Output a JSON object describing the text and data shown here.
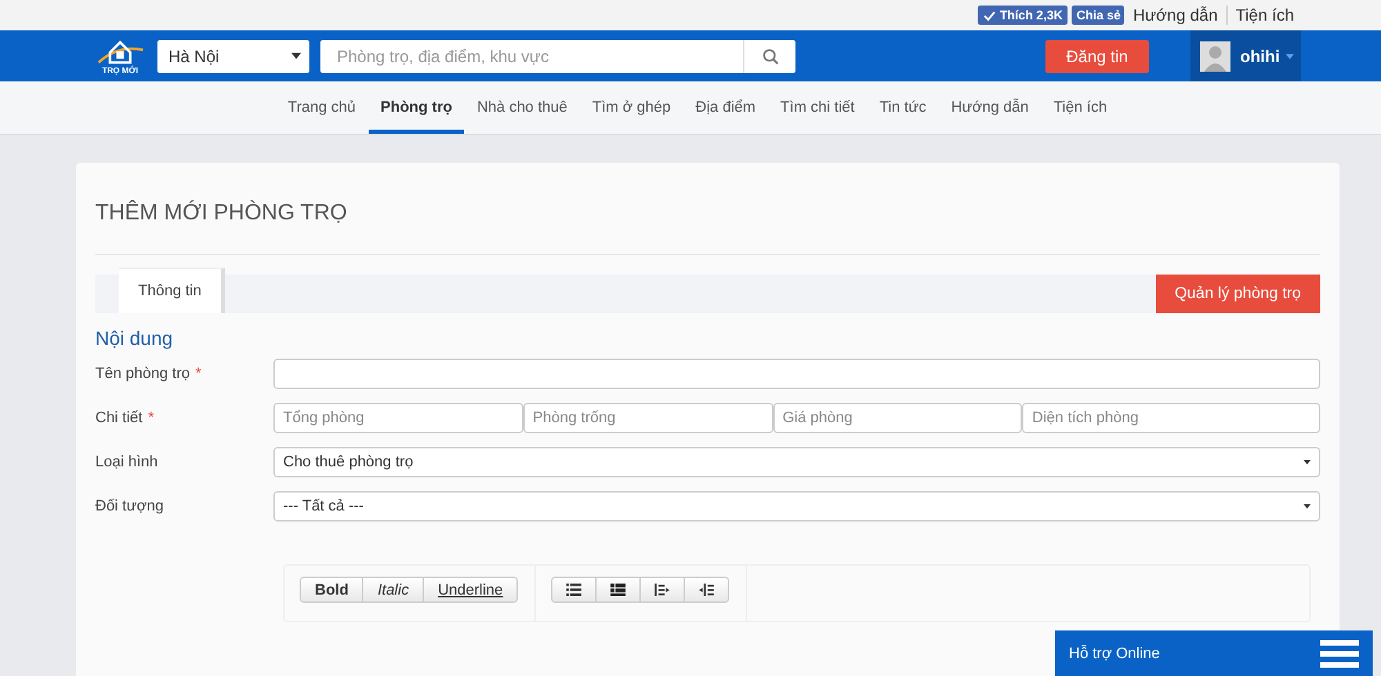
{
  "top_bar": {
    "like": "Thích 2,3K",
    "share": "Chia sẻ",
    "links": [
      "Hướng dẫn",
      "Tiện ích"
    ]
  },
  "header": {
    "logo_text": "TRỌ MỚI",
    "city": "Hà Nội",
    "search_placeholder": "Phòng trọ, địa điểm, khu vực",
    "post_button": "Đăng tin",
    "user": "ohihi"
  },
  "nav": [
    {
      "label": "Trang chủ",
      "selected": false
    },
    {
      "label": "Phòng trọ",
      "selected": true
    },
    {
      "label": "Nhà cho thuê",
      "selected": false
    },
    {
      "label": "Tìm ở ghép",
      "selected": false
    },
    {
      "label": "Địa điểm",
      "selected": false
    },
    {
      "label": "Tìm chi tiết",
      "selected": false
    },
    {
      "label": "Tin tức",
      "selected": false
    },
    {
      "label": "Hướng dẫn",
      "selected": false
    },
    {
      "label": "Tiện ích",
      "selected": false
    }
  ],
  "page_title": "THÊM MỚI PHÒNG TRỌ",
  "tabs": [
    {
      "label": "Thông tin",
      "selected": true
    }
  ],
  "manage_button": "Quản lý phòng trọ",
  "section_title": "Nội dung",
  "fields": [
    {
      "kind": "text",
      "label": "Tên phòng trọ",
      "required_mark": "*"
    },
    {
      "kind": "multi",
      "label": "Chi tiết",
      "required_mark": "*",
      "placeholders": [
        "Tổng phòng",
        "Phòng trống",
        "Giá phòng",
        "Diện tích phòng"
      ]
    },
    {
      "kind": "select",
      "label": "Loại hình",
      "value": "Cho thuê phòng trọ"
    },
    {
      "kind": "select",
      "label": "Đối tượng",
      "value": "--- Tất cả ---"
    }
  ],
  "editor_toolbar": [
    [
      {
        "kind": "bold",
        "label": "Bold"
      },
      {
        "kind": "italic",
        "label": "Italic"
      },
      {
        "kind": "underline",
        "label": "Underline"
      }
    ],
    [
      {
        "kind": "bullet-list"
      },
      {
        "kind": "numbered-list"
      },
      {
        "kind": "indent"
      },
      {
        "kind": "outdent"
      }
    ]
  ],
  "support_widget": {
    "label": "Hỗ trợ Online"
  }
}
